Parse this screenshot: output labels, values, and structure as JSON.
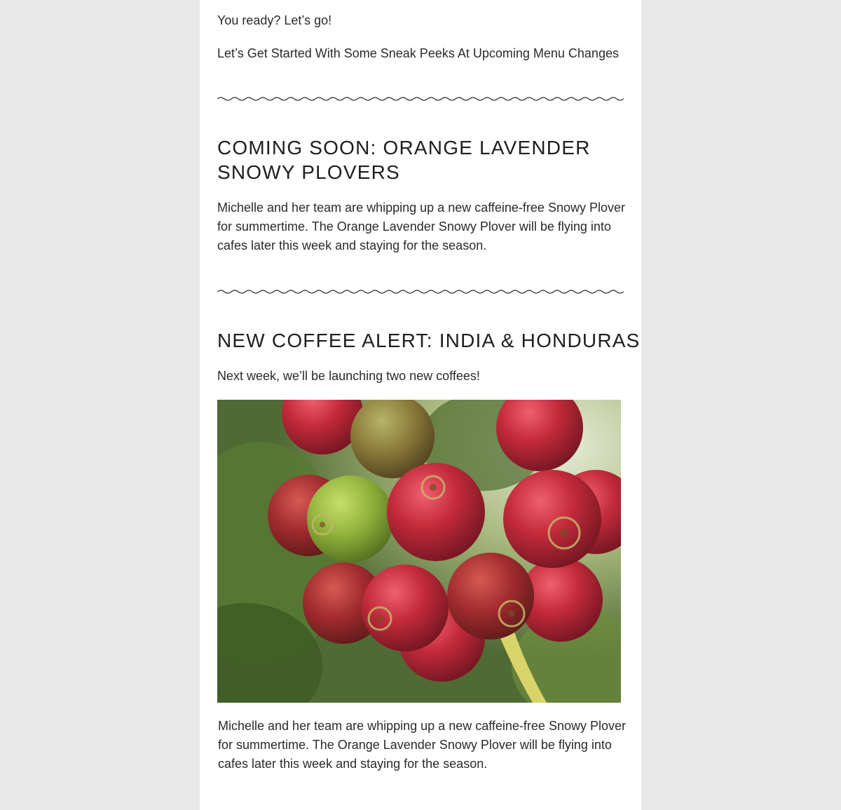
{
  "intro": {
    "greeting": "You ready? Let’s go!",
    "lead": "Let’s Get Started With Some Sneak Peeks At Upcoming Menu Changes"
  },
  "sections": [
    {
      "heading_line1": "COMING SOON: ORANGE LAVENDER",
      "heading_line2": "SNOWY PLOVERS",
      "body": "Michelle and her team are whipping up a new caffeine-free Snowy Plover for summertime. The Orange Lavender Snowy Plover will be flying into cafes later this week and staying for the season."
    },
    {
      "heading": "NEW COFFEE ALERT: INDIA & HONDURAS",
      "lead": "Next week, we’ll be launching two new coffees!",
      "image": "coffee-cherries-photo",
      "body": "Michelle and her team are whipping up a new caffeine-free Snowy Plover for summertime. The Orange Lavender Snowy Plover will be flying into cafes later this week and staying for the season."
    }
  ],
  "colors": {
    "page_background": "#e9e9e9",
    "column_background": "#ffffff",
    "text": "#222222",
    "divider": "#333333"
  }
}
